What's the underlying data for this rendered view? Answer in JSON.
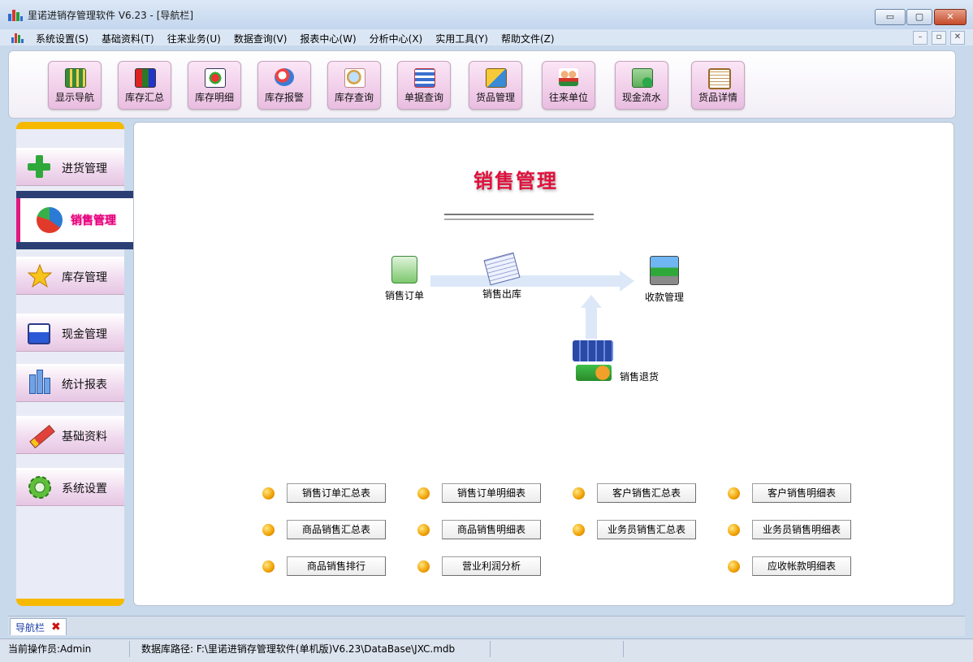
{
  "window": {
    "title": "里诺进销存管理软件 V6.23 - [导航栏]",
    "min": "▭",
    "max": "▢",
    "close": "✕"
  },
  "menu": {
    "items": [
      "系统设置(S)",
      "基础资料(T)",
      "往来业务(U)",
      "数据查询(V)",
      "报表中心(W)",
      "分析中心(X)",
      "实用工具(Y)",
      "帮助文件(Z)"
    ],
    "mdi": [
      "–",
      "▫",
      "✕"
    ]
  },
  "toolbar": [
    {
      "label": "显示导航",
      "icon": "navigation-grid-icon"
    },
    {
      "label": "库存汇总",
      "icon": "inventory-summary-icon"
    },
    {
      "label": "库存明细",
      "icon": "inventory-detail-icon"
    },
    {
      "label": "库存报警",
      "icon": "inventory-alarm-icon"
    },
    {
      "label": "库存查询",
      "icon": "inventory-search-icon"
    },
    {
      "label": "单据查询",
      "icon": "document-search-icon"
    },
    {
      "label": "货品管理",
      "icon": "goods-box-icon"
    },
    {
      "label": "往来单位",
      "icon": "contacts-people-icon"
    },
    {
      "label": "现金流水",
      "icon": "cash-flow-icon"
    },
    {
      "label": "货品详情",
      "icon": "goods-detail-clipboard-icon"
    }
  ],
  "nav": {
    "items": [
      {
        "label": "进货管理",
        "icon": "green-plus-icon"
      },
      {
        "label": "销售管理",
        "icon": "pie-chart-icon"
      },
      {
        "label": "库存管理",
        "icon": "star-icon"
      },
      {
        "label": "现金管理",
        "icon": "cash-register-icon"
      },
      {
        "label": "统计报表",
        "icon": "bar-stats-icon"
      },
      {
        "label": "基础资料",
        "icon": "pencil-icon"
      },
      {
        "label": "系统设置",
        "icon": "gear-icon"
      }
    ],
    "active_index": 1
  },
  "main": {
    "title": "销售管理",
    "flow": {
      "sales_order": "销售订单",
      "sales_out": "销售出库",
      "receipt": "收款管理",
      "sales_return": "销售退货"
    },
    "reports": [
      [
        "销售订单汇总表",
        "销售订单明细表",
        "客户销售汇总表",
        "客户销售明细表"
      ],
      [
        "商品销售汇总表",
        "商品销售明细表",
        "业务员销售汇总表",
        "业务员销售明细表"
      ],
      [
        "商品销售排行",
        "营业利润分析",
        "",
        "应收帐款明细表"
      ]
    ]
  },
  "tabs": [
    {
      "label": "导航栏",
      "close": "✖"
    }
  ],
  "status": {
    "operator": "当前操作员:Admin",
    "db_path": "数据库路径: F:\\里诺进销存管理软件(单机版)V6.23\\DataBase\\JXC.mdb"
  },
  "colors": {
    "accent": "#e0103c",
    "nav_active": "#e3007f",
    "nav_border": "#f7b800",
    "toolbar_btn": "#f0cde9"
  }
}
